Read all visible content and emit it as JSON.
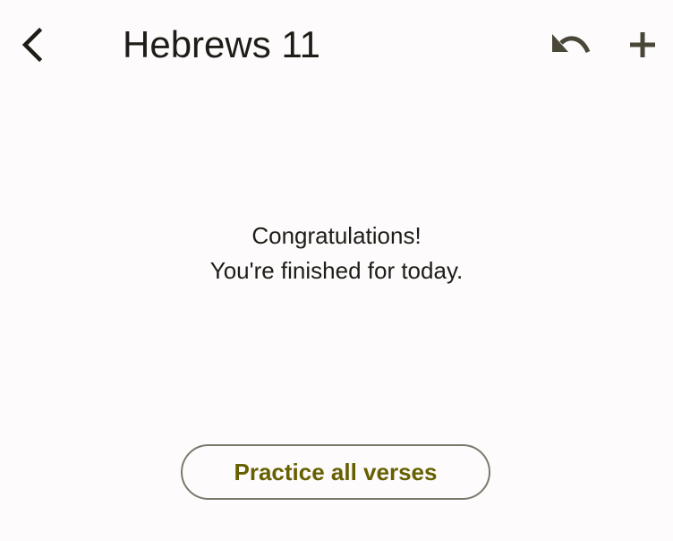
{
  "header": {
    "title": "Hebrews 11",
    "back_icon": "chevron-left-icon",
    "undo_icon": "undo-icon",
    "add_icon": "plus-icon"
  },
  "main": {
    "message_line1": "Congratulations!",
    "message_line2": "You're finished for today.",
    "practice_label": "Practice all verses"
  },
  "colors": {
    "background": "#fefbfd",
    "text": "#1f1b16",
    "icon": "#4a4739",
    "accent": "#676000",
    "outline": "#7b776c"
  }
}
